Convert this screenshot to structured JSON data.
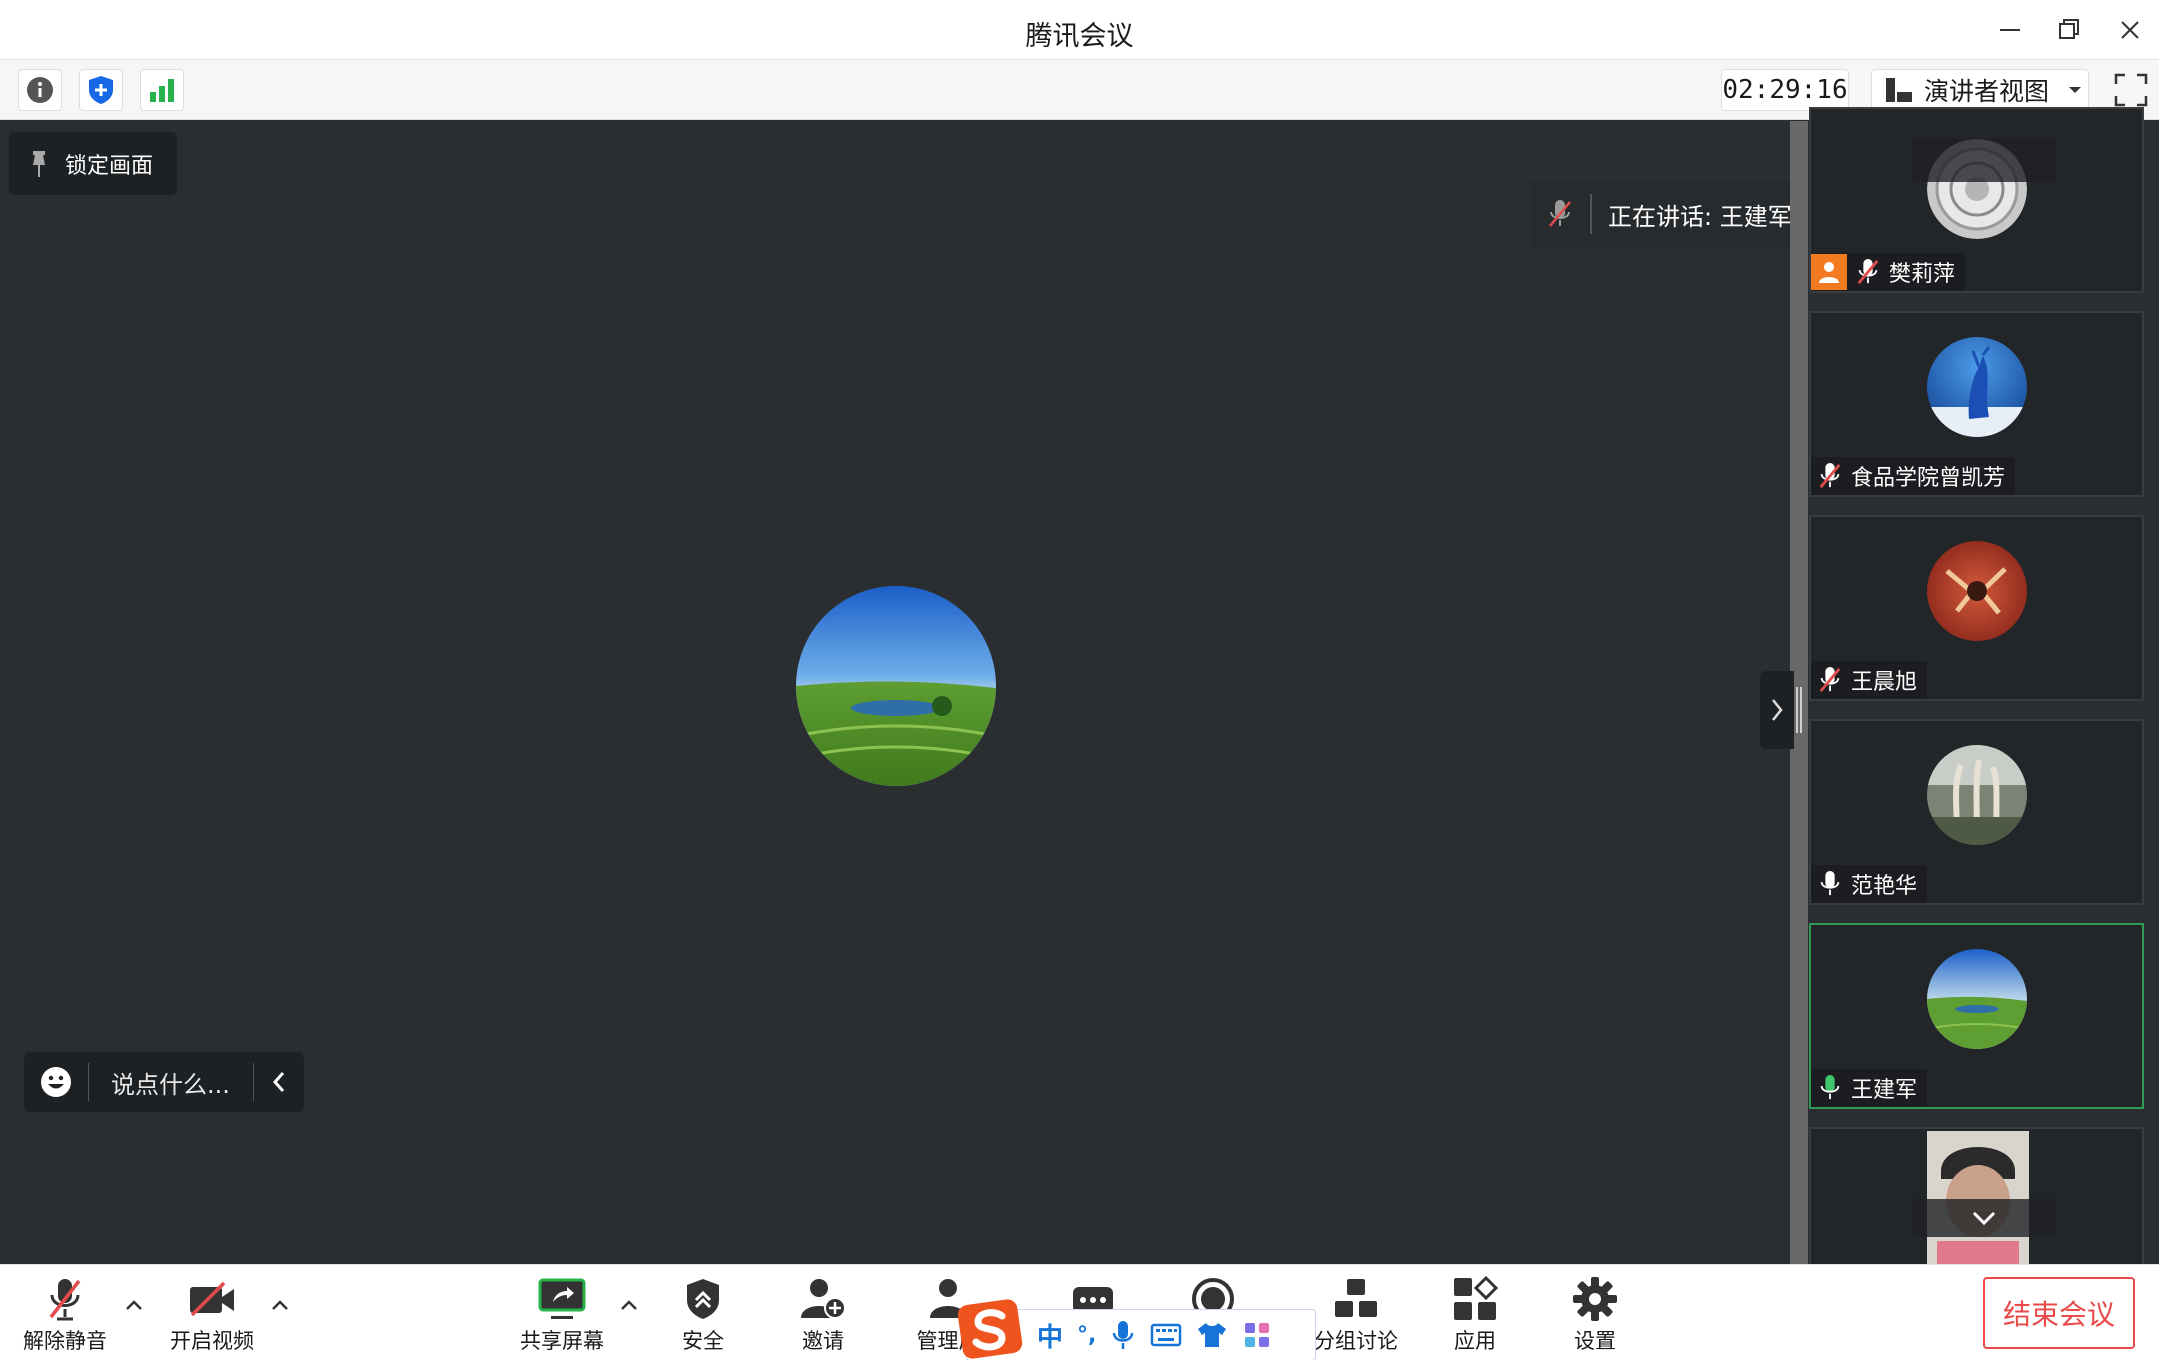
{
  "window": {
    "title": "腾讯会议"
  },
  "infobar": {
    "timer": "02:29:16",
    "view_label": "演讲者视图"
  },
  "stage": {
    "lock_label": "锁定画面",
    "speaking_text": "正在讲话: 王建军;",
    "chat_placeholder": "说点什么..."
  },
  "participants": [
    {
      "name": "樊莉萍",
      "mic": "muted"
    },
    {
      "name": "食品学院曾凯芳",
      "mic": "muted"
    },
    {
      "name": "王晨旭",
      "mic": "muted"
    },
    {
      "name": "范艳华",
      "mic": "on"
    },
    {
      "name": "王建军",
      "mic": "speaking"
    }
  ],
  "toolbar": {
    "unmute": "解除静音",
    "start_video": "开启视频",
    "share_screen": "共享屏幕",
    "security": "安全",
    "invite": "邀请",
    "manage_members": "管理成",
    "breakout": "分组讨论",
    "apps": "应用",
    "settings": "设置",
    "end_meeting": "结束会议"
  },
  "ime": {
    "mode": "中",
    "punct": "°,"
  },
  "colors": {
    "accent_green": "#2e9a55",
    "end_red": "#e84a4a",
    "ime_blue": "#1673d8",
    "muted_red": "#e34b4b"
  }
}
